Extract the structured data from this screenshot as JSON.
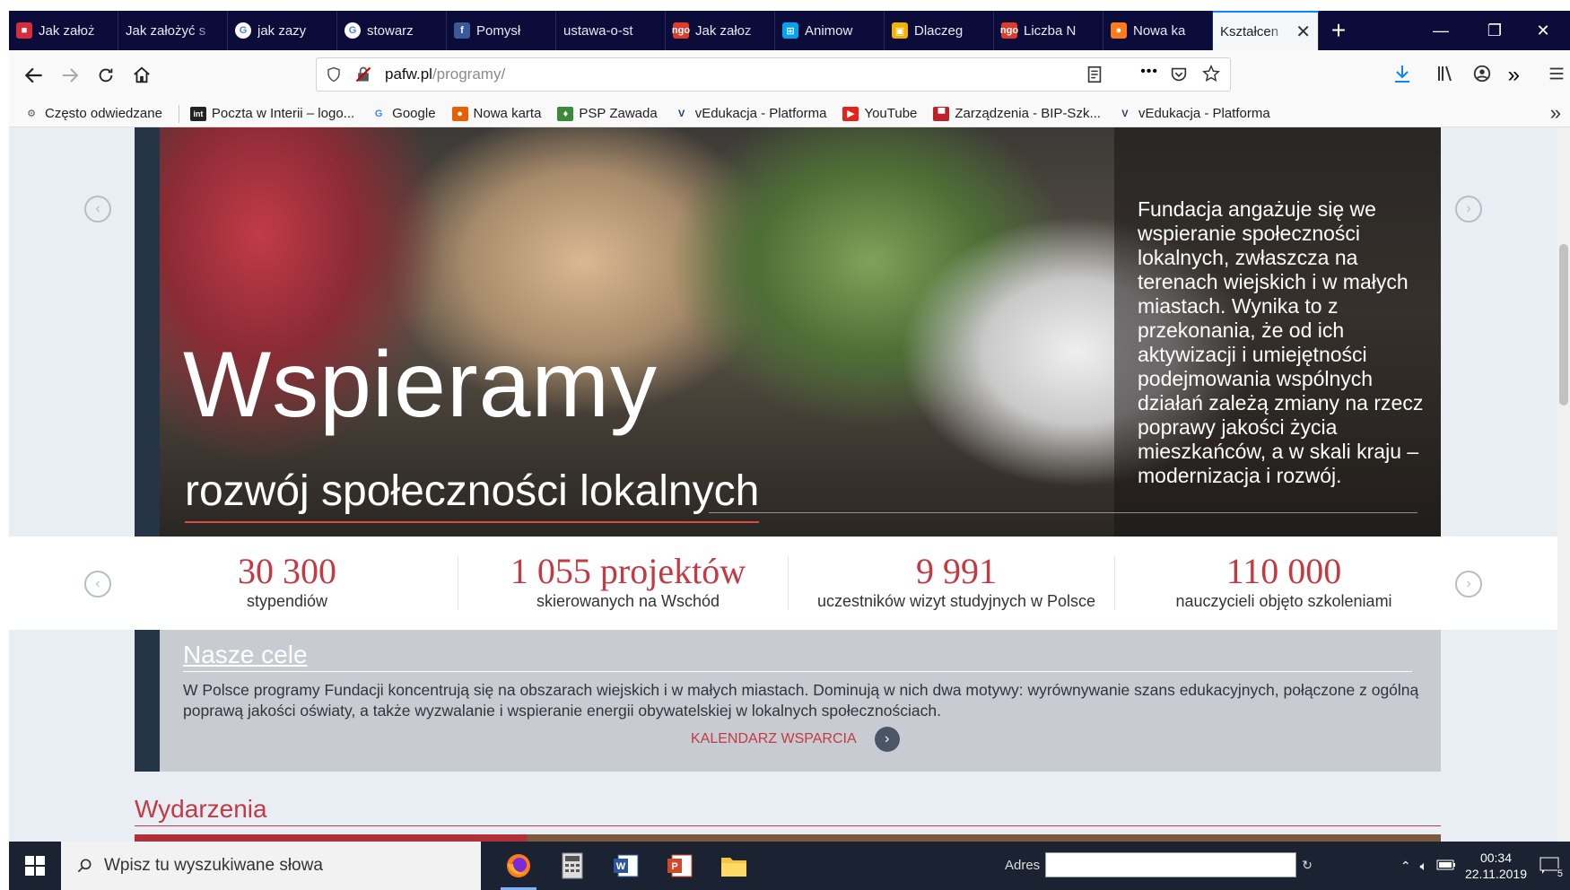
{
  "tabs": [
    {
      "label": "Jak założ",
      "favicon": "red-square"
    },
    {
      "label": "Jak założyć s",
      "favicon": "none"
    },
    {
      "label": "jak zazy",
      "favicon": "google"
    },
    {
      "label": "stowarz",
      "favicon": "google"
    },
    {
      "label": "Pomysł",
      "favicon": "facebook"
    },
    {
      "label": "ustawa-o-st",
      "favicon": "none"
    },
    {
      "label": "Jak załoz",
      "favicon": "ngo"
    },
    {
      "label": "Animow",
      "favicon": "microsoft"
    },
    {
      "label": "Dlaczeg",
      "favicon": "folder-yellow"
    },
    {
      "label": "Liczba N",
      "favicon": "ngo"
    },
    {
      "label": "Nowa ka",
      "favicon": "firefox"
    }
  ],
  "active_tab": {
    "label": "Kształcen",
    "close": "✕"
  },
  "new_tab": "+",
  "window_controls": {
    "minimize": "—",
    "restore": "❐",
    "close": "✕"
  },
  "url": {
    "host": "pafw.pl",
    "path": "/programy/"
  },
  "url_actions": {
    "more": "•••"
  },
  "bookmarks": [
    {
      "label": "Często odwiedzane",
      "icon": "gear-icon",
      "color": "#555555",
      "glyph": "⚙"
    },
    {
      "label": "Poczta w Interii – logo...",
      "icon": "interia-icon",
      "color": "#222222",
      "glyph": "int"
    },
    {
      "label": "Google",
      "icon": "google-icon",
      "color": "#4285f4",
      "glyph": "G"
    },
    {
      "label": "Nowa karta",
      "icon": "firefox-icon",
      "color": "#e66000",
      "glyph": "●"
    },
    {
      "label": "PSP Zawada",
      "icon": "school-icon",
      "color": "#3a8a3a",
      "glyph": "♦"
    },
    {
      "label": "vEdukacja - Platforma",
      "icon": "vedukacja-icon",
      "color": "#1a3a6a",
      "glyph": "V"
    },
    {
      "label": "YouTube",
      "icon": "youtube-icon",
      "color": "#e62117",
      "glyph": "▶"
    },
    {
      "label": "Zarządzenia - BIP-Szk...",
      "icon": "bip-icon",
      "color": "#c0202a",
      "glyph": "▀"
    },
    {
      "label": "vEdukacja - Platforma",
      "icon": "vedukacja-icon",
      "color": "#1a3a6a",
      "glyph": "V"
    }
  ],
  "bookmarks_overflow": "»",
  "hero": {
    "title": "Wspieramy",
    "subtitle": "rozwój społeczności lokalnych",
    "text": "Fundacja angażuje się we wspieranie społeczności lokalnych, zwłaszcza na terenach wiejskich i w małych miastach. Wynika to z przekonania, że od ich aktywizacji i umiejętności podejmowania wspólnych działań zależą zmiany na rzecz poprawy jakości życia mieszkańców, a w skali kraju – modernizacja i rozwój."
  },
  "stats": [
    {
      "value": "30 300",
      "label": "stypendiów"
    },
    {
      "value": "1 055 projektów",
      "label": "skierowanych na Wschód"
    },
    {
      "value": "9 991",
      "label": "uczestników wizyt studyjnych w Polsce"
    },
    {
      "value": "110 000",
      "label": "nauczycieli objęto szkoleniami"
    }
  ],
  "goals": {
    "title": "Nasze cele",
    "text": "W Polsce programy Fundacji koncentrują się na obszarach wiejskich i w małych miastach. Dominują w nich dwa motywy: wyrównywanie szans edukacyjnych, połączone z ogólną poprawą jakości oświaty, a także wyzwalanie i wspieranie energii obywatelskiej w lokalnych społecznościach.",
    "link": "KALENDARZ WSPARCIA"
  },
  "events_title": "Wydarzenia",
  "taskbar": {
    "search_placeholder": "Wpisz tu wyszukiwane słowa",
    "address_label": "Adres",
    "time": "00:34",
    "date": "22.11.2019",
    "notifications": "5"
  },
  "colors": {
    "accent": "#c33a43",
    "tabstrip": "#0c0c3a",
    "navy": "#253447"
  }
}
